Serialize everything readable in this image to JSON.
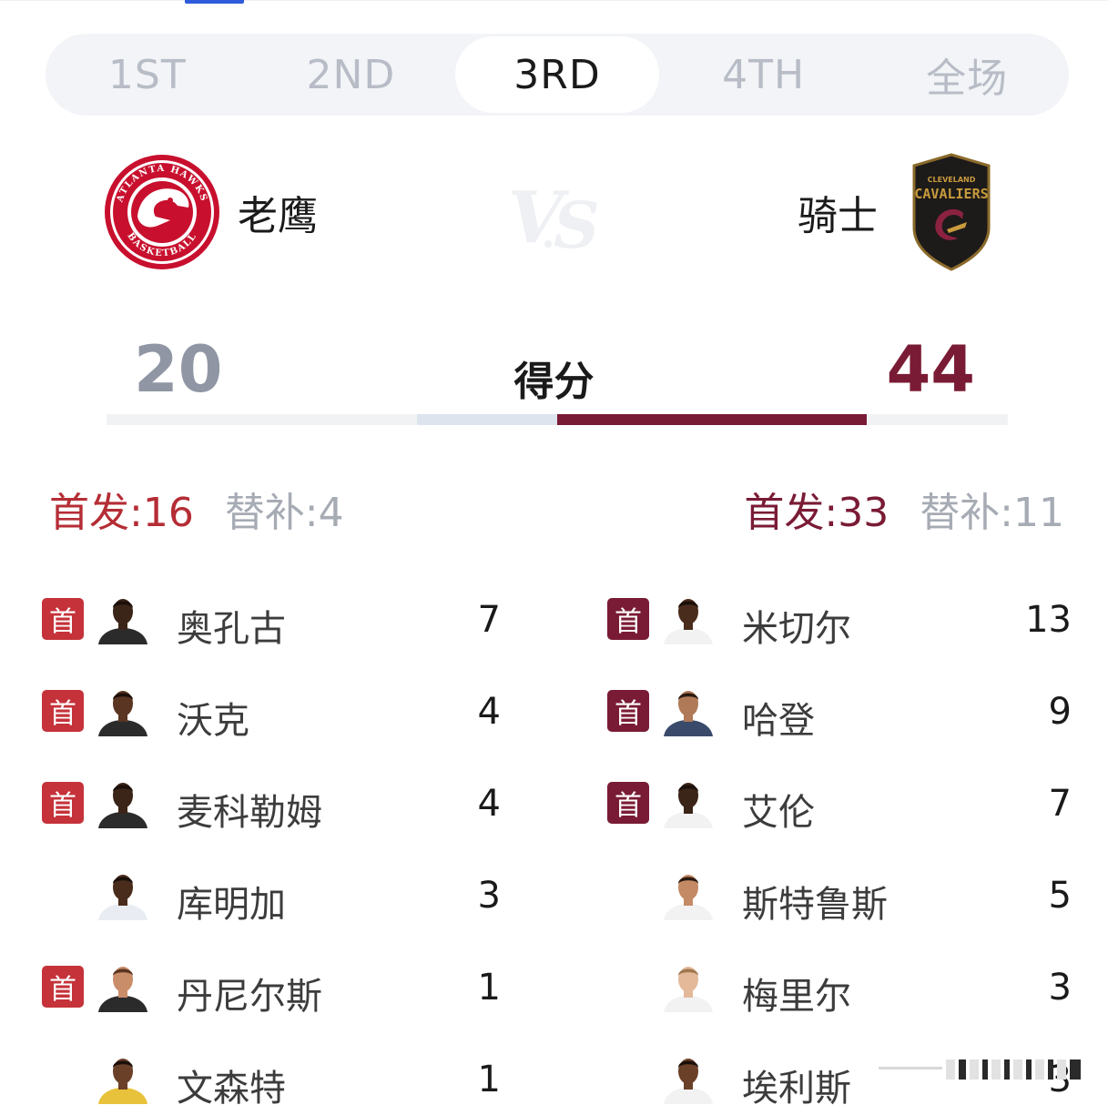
{
  "tabs": [
    {
      "label": "1ST",
      "active": false
    },
    {
      "label": "2ND",
      "active": false
    },
    {
      "label": "3RD",
      "active": true
    },
    {
      "label": "4TH",
      "active": false
    },
    {
      "label": "全场",
      "active": false
    }
  ],
  "home": {
    "name": "老鹰",
    "logo_icon": "atlanta-hawks-logo",
    "logo_text": "ATLANTA HAWKS BASKETBALL",
    "score": "20",
    "starters_label": "首发:16",
    "bench_label": "替补:4",
    "color": "#c5323a"
  },
  "away": {
    "name": "骑士",
    "logo_icon": "cleveland-cavaliers-logo",
    "logo_text": "CLEVELAND CAVALIERS",
    "score": "44",
    "starters_label": "首发:33",
    "bench_label": "替补:11",
    "color": "#7a1b35"
  },
  "vs_icon": "vs-watermark",
  "score_label": "得分",
  "starter_badge": "首",
  "score_share": {
    "home": 20,
    "away": 44
  },
  "home_players": [
    {
      "name": "奥孔古",
      "points": "7",
      "starter": true
    },
    {
      "name": "沃克",
      "points": "4",
      "starter": true
    },
    {
      "name": "麦科勒姆",
      "points": "4",
      "starter": true
    },
    {
      "name": "库明加",
      "points": "3",
      "starter": false
    },
    {
      "name": "丹尼尔斯",
      "points": "1",
      "starter": true
    },
    {
      "name": "文森特",
      "points": "1",
      "starter": false
    }
  ],
  "away_players": [
    {
      "name": "米切尔",
      "points": "13",
      "starter": true
    },
    {
      "name": "哈登",
      "points": "9",
      "starter": true
    },
    {
      "name": "艾伦",
      "points": "7",
      "starter": true
    },
    {
      "name": "斯特鲁斯",
      "points": "5",
      "starter": false
    },
    {
      "name": "梅里尔",
      "points": "3",
      "starter": false
    },
    {
      "name": "埃利斯",
      "points": "3",
      "starter": false
    }
  ]
}
